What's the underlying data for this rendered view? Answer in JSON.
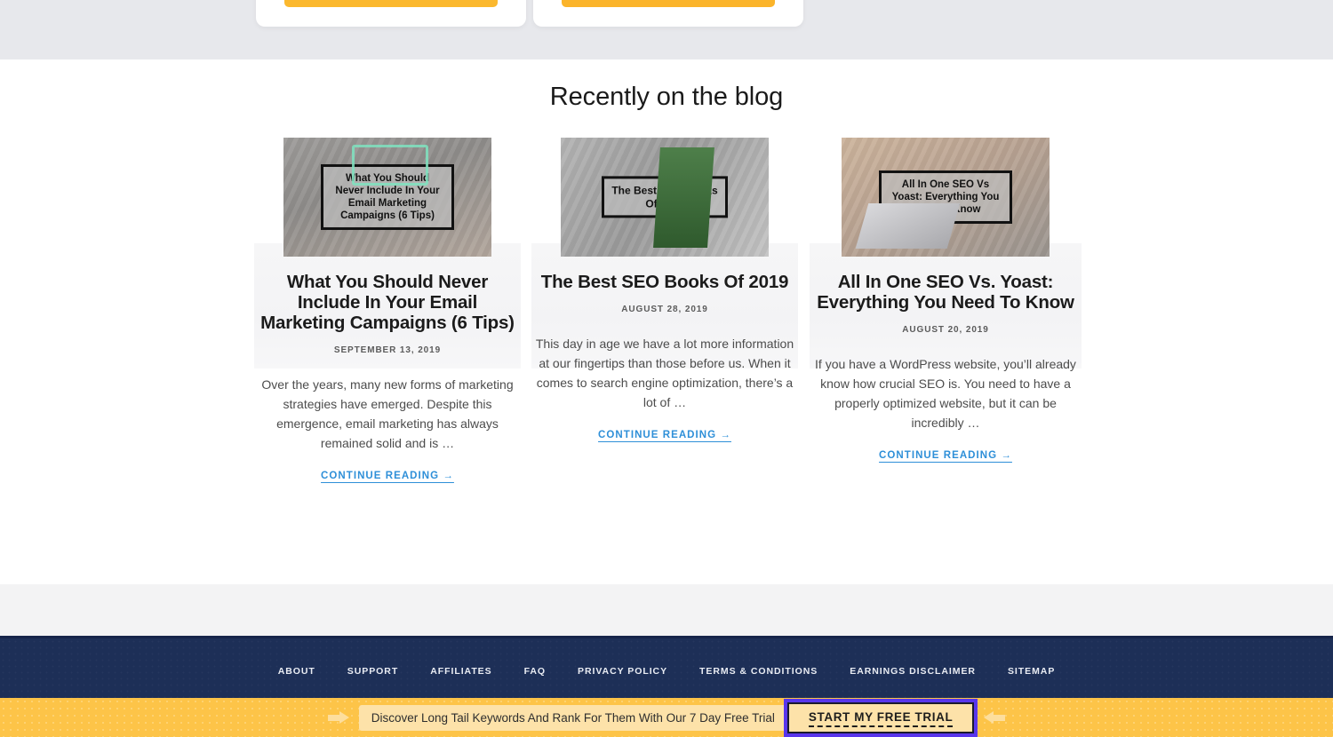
{
  "pricing_preview": {
    "cards": [
      {
        "button_label": ""
      },
      {
        "button_label": ""
      }
    ]
  },
  "blog": {
    "heading": "Recently on the blog",
    "posts": [
      {
        "thumb_caption": "What You Should\nNever Include In Your\nEmail Marketing\nCampaigns (6 Tips)",
        "title": "What You Should Never Include In Your Email Marketing Campaigns (6 Tips)",
        "date": "SEPTEMBER 13, 2019",
        "excerpt": "Over the years, many new forms of marketing strategies have emerged. Despite this emergence, email marketing has always remained solid and is …",
        "continue_label": "CONTINUE READING →"
      },
      {
        "thumb_caption": "The Best SEO Books\nOf 2019",
        "title": "The Best SEO Books Of 2019",
        "date": "AUGUST 28, 2019",
        "excerpt": "This day in age we have a lot more information at our fingertips than those before us. When it comes to search engine optimization, there’s a lot of …",
        "continue_label": "CONTINUE READING →"
      },
      {
        "thumb_caption": "All In One SEO Vs\nYoast: Everything You\nNeed To Know",
        "title": "All In One SEO Vs. Yoast: Everything You Need To Know",
        "date": "AUGUST 20, 2019",
        "excerpt": "If you have a WordPress website, you’ll already know how crucial SEO is. You need to have a properly optimized website, but it can be incredibly …",
        "continue_label": "CONTINUE READING →"
      }
    ]
  },
  "footer": {
    "links": [
      {
        "label": "ABOUT"
      },
      {
        "label": "SUPPORT"
      },
      {
        "label": "AFFILIATES"
      },
      {
        "label": "FAQ"
      },
      {
        "label": "PRIVACY POLICY"
      },
      {
        "label": "TERMS & CONDITIONS"
      },
      {
        "label": "EARNINGS DISCLAIMER"
      },
      {
        "label": "SITEMAP"
      }
    ]
  },
  "cta_bar": {
    "message": "Discover Long Tail Keywords And Rank For Them With Our 7 Day Free Trial",
    "button_label": "START MY FREE TRIAL",
    "highlight_color": "#5936ec",
    "bar_color": "#fdc448"
  }
}
